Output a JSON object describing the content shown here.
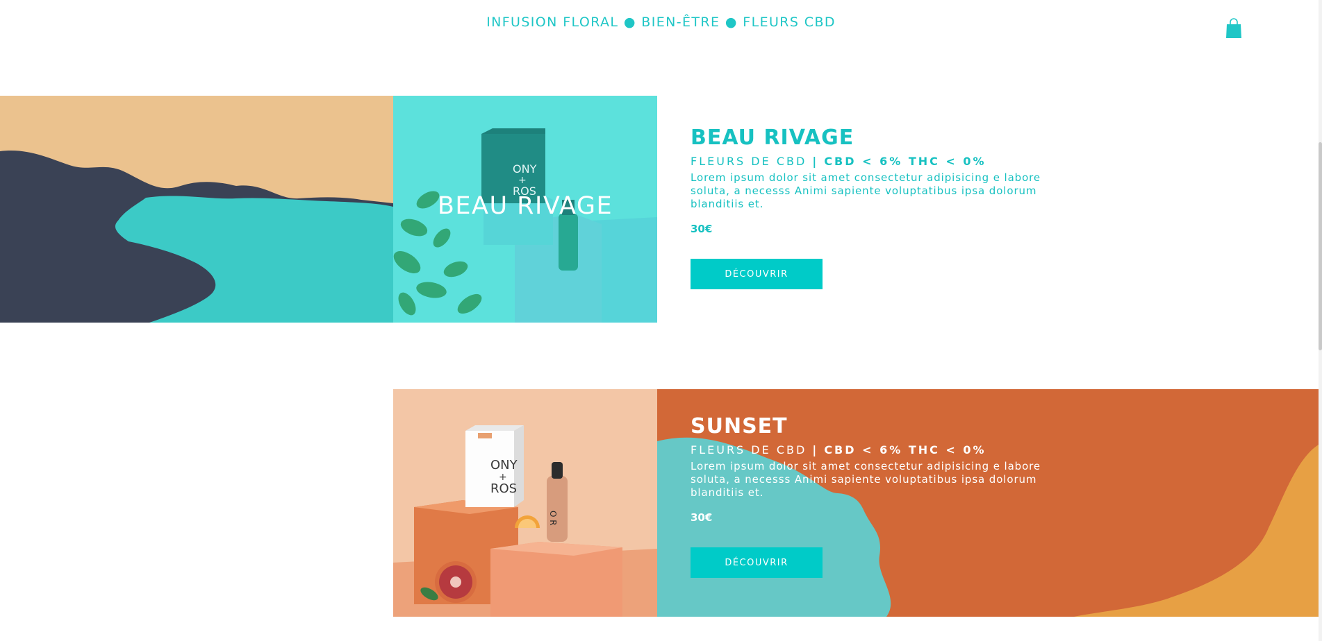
{
  "header": {
    "tagline": "INFUSION FLORAL ● BIEN-ÊTRE ● FLEURS CBD"
  },
  "products": [
    {
      "photo_title": "BEAU RIVAGE",
      "title": "BEAU RIVAGE",
      "category": "FLEURS DE CBD",
      "separator": "|",
      "specs": "CBD < 6% THC < 0%",
      "description": "Lorem ipsum dolor sit amet consectetur adipisicing e labore soluta, a necesss Animi sapiente voluptatibus ipsa dolorum blanditiis et.",
      "price": "30€",
      "button_label": "DÉCOUVRIR"
    },
    {
      "title": "SUNSET",
      "category": "FLEURS DE CBD",
      "separator": "|",
      "specs": "CBD < 6% THC < 0%",
      "description": "Lorem ipsum dolor sit amet consectetur adipisicing e labore soluta, a necesss Animi sapiente voluptatibus ipsa dolorum blanditiis et.",
      "price": "30€",
      "button_label": "DÉCOUVRIR"
    }
  ],
  "package_text": {
    "brand_top": "ONY",
    "brand_plus": "+",
    "brand_bottom": "ROS",
    "bottle_text": "O R"
  },
  "icons": {
    "cart": "shopping-bag-icon"
  },
  "colors": {
    "accent": "#00cbc8",
    "sand": "#ebc28e",
    "navy": "#3a4255",
    "lagoon": "#3ccac6",
    "sunset_orange": "#d26837",
    "peach": "#f3c6a6"
  }
}
